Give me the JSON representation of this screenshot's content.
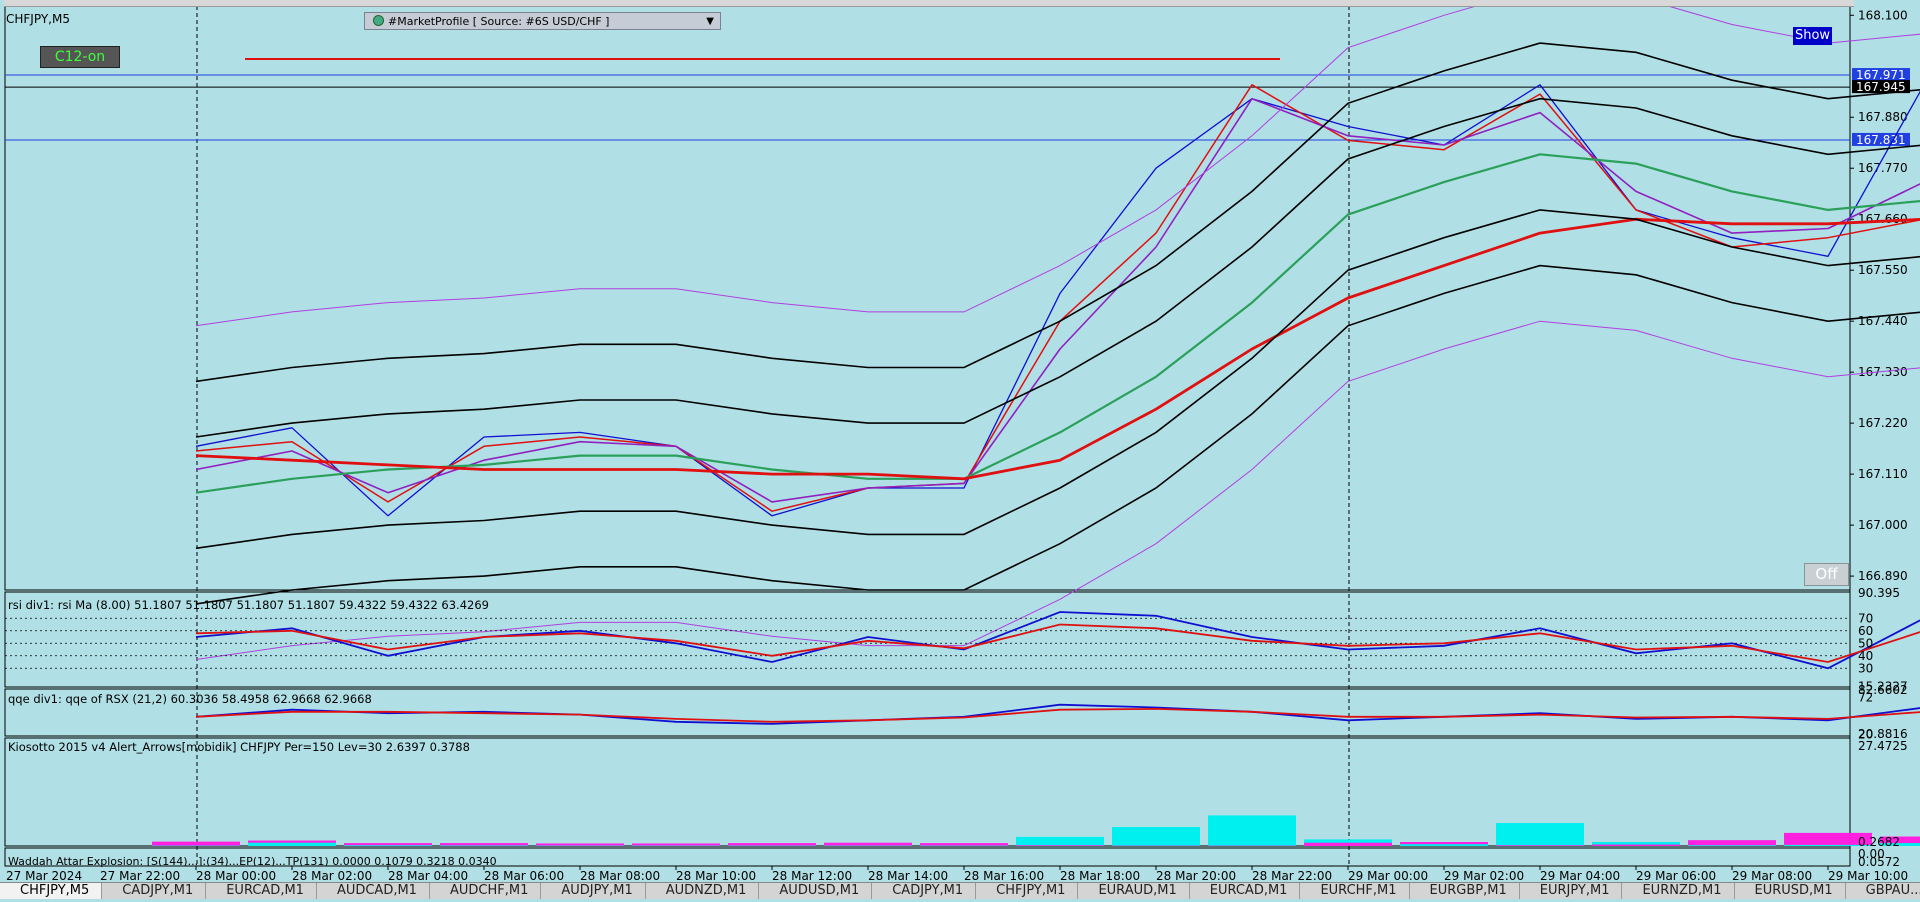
{
  "window": {
    "symbol_title": "CHFJPY,M5",
    "c12_button": "C12-on",
    "market_profile_label": "#MarketProfile [ Source: #6S USD/CHF ]",
    "show_button": "Show",
    "off_button": "Off"
  },
  "price_axis": {
    "ticks": [
      "168.100",
      "167.880",
      "167.770",
      "167.660",
      "167.550",
      "167.440",
      "167.330",
      "167.220",
      "167.110",
      "167.000",
      "166.890"
    ],
    "tags": [
      "167.971",
      "167.945",
      "167.831"
    ]
  },
  "time_axis": [
    "27 Mar 2024",
    "27 Mar 22:00",
    "28 Mar 00:00",
    "28 Mar 02:00",
    "28 Mar 04:00",
    "28 Mar 06:00",
    "28 Mar 08:00",
    "28 Mar 10:00",
    "28 Mar 12:00",
    "28 Mar 14:00",
    "28 Mar 16:00",
    "28 Mar 18:00",
    "28 Mar 20:00",
    "28 Mar 22:00",
    "29 Mar 00:00",
    "29 Mar 02:00",
    "29 Mar 04:00",
    "29 Mar 06:00",
    "29 Mar 08:00",
    "29 Mar 10:00"
  ],
  "indicators": {
    "rsi": {
      "label": "rsi div1: rsi Ma (8.00) 51.1807 51.1807 51.1807 51.1807 59.4322 59.4322 63.4269",
      "axis": [
        "90.395",
        "70",
        "60",
        "50",
        "40",
        "30",
        "15.2327"
      ]
    },
    "qqe": {
      "label": "qqe div1: qqe of RSX (21,2) 60.3036 58.4958 62.9668 62.9668",
      "axis": [
        "82.6602",
        "72",
        "20.8816",
        "20"
      ]
    },
    "kiosotto": {
      "label": "Kiosotto 2015 v4 Alert_Arrows[mobidik] CHFJPY Per=150 Lev=30 2.6397 0.3788",
      "axis": [
        "27.4725",
        "0.2682",
        "0.00"
      ]
    },
    "waddah": {
      "label": "Waddah Attar Explosion: [S(144)...]:(34)...EP(12)...TP(131) 0.0000 0.1079 0.3218 0.0340",
      "axis": [
        "0.0572"
      ]
    }
  },
  "tabs": [
    "CHFJPY,M5",
    "CADJPY,M1",
    "EURCAD,M1",
    "AUDCAD,M1",
    "AUDCHF,M1",
    "AUDJPY,M1",
    "AUDNZD,M1",
    "AUDUSD,M1",
    "CADJPY,M1",
    "CHFJPY,M1",
    "EURAUD,M1",
    "EURCAD,M1",
    "EURCHF,M1",
    "EURGBP,M1",
    "EURJPY,M1",
    "EURNZD,M1",
    "EURUSD,M1",
    "GBPAU..."
  ],
  "chart_data": {
    "type": "line",
    "symbol": "CHFJPY",
    "timeframe": "M5",
    "ylim": [
      166.86,
      168.12
    ],
    "grid": false,
    "x": [
      "27 Mar 22:00",
      "28 Mar 00:00",
      "28 Mar 02:00",
      "28 Mar 04:00",
      "28 Mar 06:00",
      "28 Mar 08:00",
      "28 Mar 10:00",
      "28 Mar 12:00",
      "28 Mar 14:00",
      "28 Mar 16:00",
      "28 Mar 18:00",
      "28 Mar 20:00",
      "28 Mar 22:00",
      "29 Mar 00:00",
      "29 Mar 02:00",
      "29 Mar 04:00",
      "29 Mar 06:00",
      "29 Mar 08:00",
      "29 Mar 10:00"
    ],
    "series": [
      {
        "color": "#1010d0",
        "values": [
          167.17,
          167.21,
          167.02,
          167.19,
          167.2,
          167.17,
          167.02,
          167.08,
          167.08,
          167.5,
          167.77,
          167.92,
          167.86,
          167.82,
          167.95,
          167.68,
          167.62,
          167.58,
          167.95
        ]
      },
      {
        "color": "#e01010",
        "values": [
          167.16,
          167.18,
          167.05,
          167.17,
          167.19,
          167.17,
          167.03,
          167.08,
          167.09,
          167.44,
          167.63,
          167.95,
          167.83,
          167.81,
          167.93,
          167.68,
          167.6,
          167.62,
          167.66
        ]
      },
      {
        "color": "#9020c0",
        "values": [
          167.12,
          167.16,
          167.07,
          167.14,
          167.18,
          167.17,
          167.05,
          167.08,
          167.09,
          167.38,
          167.6,
          167.92,
          167.84,
          167.82,
          167.89,
          167.72,
          167.63,
          167.64,
          167.74
        ]
      },
      {
        "color": "#2aa05a",
        "values": [
          167.07,
          167.1,
          167.12,
          167.13,
          167.15,
          167.15,
          167.12,
          167.1,
          167.1,
          167.2,
          167.32,
          167.48,
          167.67,
          167.74,
          167.8,
          167.78,
          167.72,
          167.68,
          167.7
        ]
      },
      {
        "color": "#e01010",
        "values": [
          167.15,
          167.14,
          167.13,
          167.12,
          167.12,
          167.12,
          167.11,
          167.11,
          167.1,
          167.14,
          167.25,
          167.38,
          167.49,
          167.56,
          167.63,
          167.66,
          167.65,
          167.65,
          167.66
        ]
      }
    ],
    "rsi_series": [
      {
        "color": "#1010d0",
        "values": [
          55,
          62,
          40,
          55,
          60,
          50,
          35,
          55,
          45,
          75,
          72,
          55,
          45,
          48,
          62,
          42,
          50,
          30,
          70
        ]
      },
      {
        "color": "#e01010",
        "values": [
          58,
          60,
          45,
          55,
          58,
          52,
          40,
          52,
          46,
          65,
          62,
          52,
          48,
          50,
          58,
          45,
          48,
          35,
          60
        ]
      }
    ],
    "qqe_series": [
      {
        "color": "#1010d0",
        "values": [
          45,
          55,
          50,
          52,
          48,
          38,
          35,
          40,
          45,
          62,
          58,
          52,
          40,
          45,
          50,
          42,
          45,
          40,
          58
        ]
      },
      {
        "color": "#e01010",
        "values": [
          45,
          52,
          52,
          50,
          48,
          42,
          38,
          40,
          44,
          55,
          56,
          52,
          45,
          45,
          48,
          44,
          45,
          42,
          52
        ]
      }
    ],
    "kiosotto": {
      "cyan": [
        0.1,
        0.9,
        0.2,
        0.15,
        0.1,
        0.1,
        0.1,
        0.1,
        0.1,
        2.5,
        5.2,
        8.4,
        1.8,
        0.5,
        6.3,
        1.1,
        0.2,
        0.3,
        0.8
      ],
      "magenta": [
        1.2,
        1.5,
        0.8,
        0.8,
        0.7,
        0.7,
        0.8,
        0.9,
        0.8,
        0.2,
        0.1,
        0.1,
        0.9,
        1.1,
        0.2,
        0.4,
        1.6,
        3.6,
        2.6
      ]
    }
  }
}
